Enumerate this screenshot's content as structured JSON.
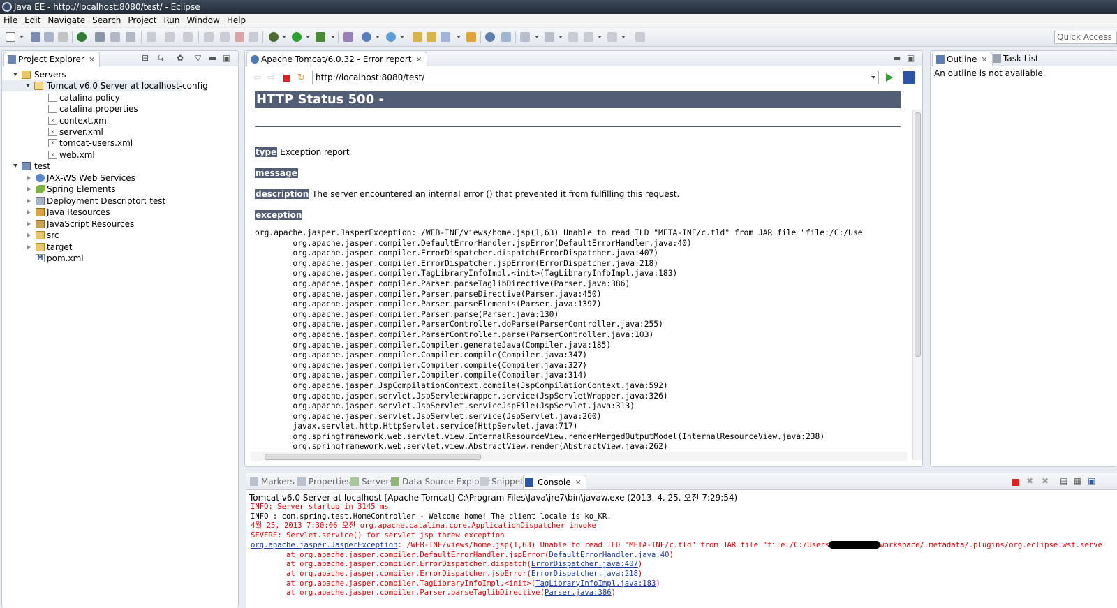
{
  "window": {
    "title": "Java EE - http://localhost:8080/test/ - Eclipse"
  },
  "menu": [
    "File",
    "Edit",
    "Navigate",
    "Search",
    "Project",
    "Run",
    "Window",
    "Help"
  ],
  "toolbar": {
    "quick_access": "Quick Access"
  },
  "project_explorer": {
    "tab": "Project Explorer",
    "tree": [
      "Servers",
      "Tomcat v6.0 Server at localhost-config",
      "catalina.policy",
      "catalina.properties",
      "context.xml",
      "server.xml",
      "tomcat-users.xml",
      "web.xml",
      "test",
      "JAX-WS Web Services",
      "Spring Elements",
      "Deployment Descriptor: test",
      "Java Resources",
      "JavaScript Resources",
      "src",
      "target",
      "pom.xml"
    ]
  },
  "browser": {
    "tab": "Apache Tomcat/6.0.32 - Error report",
    "url": "http://localhost:8080/test/",
    "heading": "HTTP Status 500 -",
    "type_label": "type",
    "type_value": " Exception report",
    "message_label": "message",
    "description_label": "description",
    "description_value": "The server encountered an internal error () that prevented it from fulfilling this request.",
    "exception_label": "exception",
    "stack": [
      "org.apache.jasper.JasperException: /WEB-INF/views/home.jsp(1,63) Unable to read TLD \"META-INF/c.tld\" from JAR file \"file:/C:/Use",
      "\torg.apache.jasper.compiler.DefaultErrorHandler.jspError(DefaultErrorHandler.java:40)",
      "\torg.apache.jasper.compiler.ErrorDispatcher.dispatch(ErrorDispatcher.java:407)",
      "\torg.apache.jasper.compiler.ErrorDispatcher.jspError(ErrorDispatcher.java:218)",
      "\torg.apache.jasper.compiler.TagLibraryInfoImpl.<init>(TagLibraryInfoImpl.java:183)",
      "\torg.apache.jasper.compiler.Parser.parseTaglibDirective(Parser.java:386)",
      "\torg.apache.jasper.compiler.Parser.parseDirective(Parser.java:450)",
      "\torg.apache.jasper.compiler.Parser.parseElements(Parser.java:1397)",
      "\torg.apache.jasper.compiler.Parser.parse(Parser.java:130)",
      "\torg.apache.jasper.compiler.ParserController.doParse(ParserController.java:255)",
      "\torg.apache.jasper.compiler.ParserController.parse(ParserController.java:103)",
      "\torg.apache.jasper.compiler.Compiler.generateJava(Compiler.java:185)",
      "\torg.apache.jasper.compiler.Compiler.compile(Compiler.java:347)",
      "\torg.apache.jasper.compiler.Compiler.compile(Compiler.java:327)",
      "\torg.apache.jasper.compiler.Compiler.compile(Compiler.java:314)",
      "\torg.apache.jasper.JspCompilationContext.compile(JspCompilationContext.java:592)",
      "\torg.apache.jasper.servlet.JspServletWrapper.service(JspServletWrapper.java:326)",
      "\torg.apache.jasper.servlet.JspServlet.serviceJspFile(JspServlet.java:313)",
      "\torg.apache.jasper.servlet.JspServlet.service(JspServlet.java:260)",
      "\tjavax.servlet.http.HttpServlet.service(HttpServlet.java:717)",
      "\torg.springframework.web.servlet.view.InternalResourceView.renderMergedOutputModel(InternalResourceView.java:238)",
      "\torg.springframework.web.servlet.view.AbstractView.render(AbstractView.java:262)"
    ]
  },
  "outline": {
    "tab": "Outline",
    "task_tab": "Task List",
    "message": "An outline is not available."
  },
  "bottom_tabs": [
    "Markers",
    "Properties",
    "Servers",
    "Data Source Explorer",
    "Snippets",
    "Console"
  ],
  "console": {
    "description": "Tomcat v6.0 Server at localhost [Apache Tomcat] C:\\Program Files\\Java\\jre7\\bin\\javaw.exe (2013. 4. 25. 오전 7:29:54)",
    "l1": "INFO: Server startup in 3145 ms",
    "l2": "INFO : com.spring.test.HomeController - Welcome home! The client locale is ko_KR.",
    "l3": "4월 25, 2013 7:30:06 오전 org.apache.catalina.core.ApplicationDispatcher invoke",
    "l4": "SEVERE: Servlet.service() for servlet jsp threw exception",
    "l5_link": "org.apache.jasper.JasperException",
    "l5_a": ": /WEB-INF/views/home.jsp(1,63) Unable to read TLD \"META-INF/c.tld\" from JAR file \"file:/C:/Users",
    "l5_b": "workspace/.metadata/.plugins/org.eclipse.wst.serve",
    "frames": [
      {
        "pre": "\tat org.apache.jasper.compiler.DefaultErrorHandler.jspError(",
        "link": "DefaultErrorHandler.java:40",
        "post": ")"
      },
      {
        "pre": "\tat org.apache.jasper.compiler.ErrorDispatcher.dispatch(",
        "link": "ErrorDispatcher.java:407",
        "post": ")"
      },
      {
        "pre": "\tat org.apache.jasper.compiler.ErrorDispatcher.jspError(",
        "link": "ErrorDispatcher.java:218",
        "post": ")"
      },
      {
        "pre": "\tat org.apache.jasper.compiler.TagLibraryInfoImpl.<init>(",
        "link": "TagLibraryInfoImpl.java:183",
        "post": ")"
      },
      {
        "pre": "\tat org.apache.jasper.compiler.Parser.parseTaglibDirective(",
        "link": "Parser.java:386",
        "post": ")"
      }
    ]
  }
}
